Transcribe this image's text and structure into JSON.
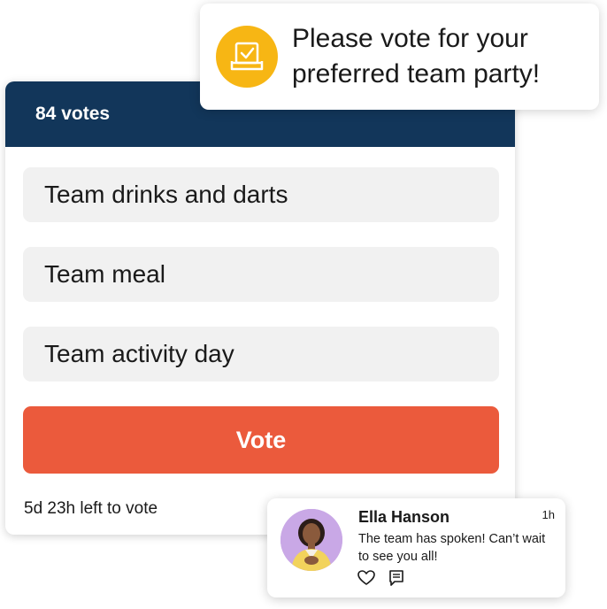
{
  "poll": {
    "votes_label": "84 votes",
    "options": [
      {
        "label": "Team drinks and darts"
      },
      {
        "label": "Team meal"
      },
      {
        "label": "Team activity day"
      }
    ],
    "vote_button": "Vote",
    "time_left": "5d 23h left to vote"
  },
  "prompt": {
    "icon": "ballot-box-icon",
    "text_line1": "Please vote for your",
    "text_line2": "preferred team party!"
  },
  "comment": {
    "author": "Ella Hanson",
    "time": "1h",
    "text": "The team has spoken! Can’t wait to see you all!",
    "actions": [
      "heart-icon",
      "comment-icon"
    ]
  },
  "colors": {
    "header_bg": "#12365a",
    "accent": "#eb5a3c",
    "icon_bg": "#f7b614",
    "avatar_bg": "#c9a8e6"
  }
}
